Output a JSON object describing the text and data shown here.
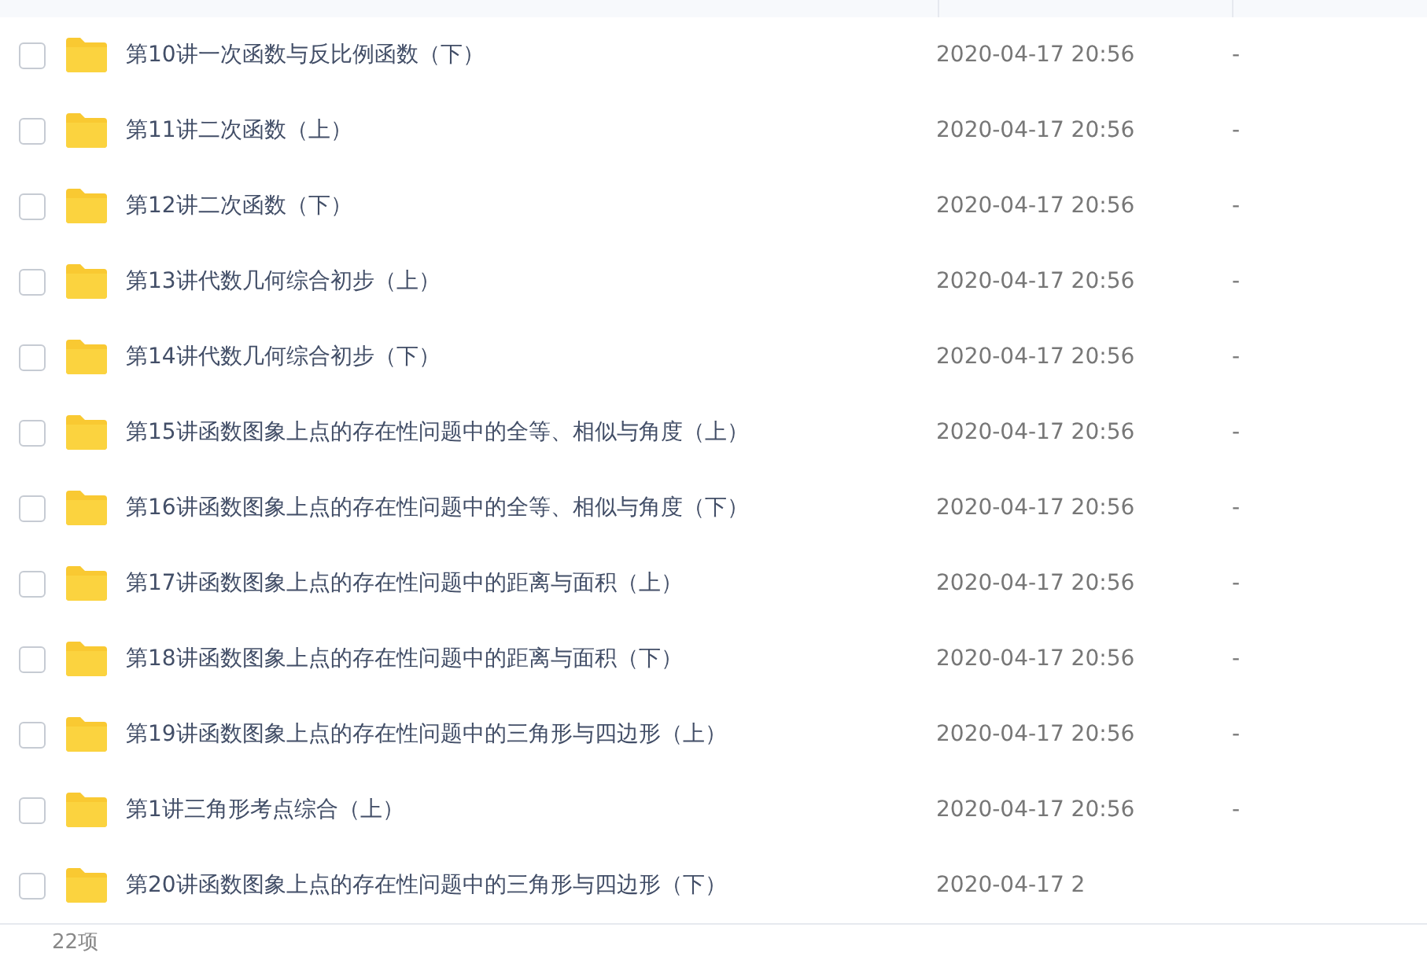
{
  "files": [
    {
      "name": "第10讲一次函数与反比例函数（下）",
      "modified": "2020-04-17 20:56",
      "size": "-",
      "checked": false
    },
    {
      "name": "第11讲二次函数（上）",
      "modified": "2020-04-17 20:56",
      "size": "-",
      "checked": false
    },
    {
      "name": "第12讲二次函数（下）",
      "modified": "2020-04-17 20:56",
      "size": "-",
      "checked": false
    },
    {
      "name": "第13讲代数几何综合初步（上）",
      "modified": "2020-04-17 20:56",
      "size": "-",
      "checked": false
    },
    {
      "name": "第14讲代数几何综合初步（下）",
      "modified": "2020-04-17 20:56",
      "size": "-",
      "checked": false
    },
    {
      "name": "第15讲函数图象上点的存在性问题中的全等、相似与角度（上）",
      "modified": "2020-04-17 20:56",
      "size": "-",
      "checked": false
    },
    {
      "name": "第16讲函数图象上点的存在性问题中的全等、相似与角度（下）",
      "modified": "2020-04-17 20:56",
      "size": "-",
      "checked": false
    },
    {
      "name": "第17讲函数图象上点的存在性问题中的距离与面积（上）",
      "modified": "2020-04-17 20:56",
      "size": "-",
      "checked": false
    },
    {
      "name": "第18讲函数图象上点的存在性问题中的距离与面积（下）",
      "modified": "2020-04-17 20:56",
      "size": "-",
      "checked": false
    },
    {
      "name": "第19讲函数图象上点的存在性问题中的三角形与四边形（上）",
      "modified": "2020-04-17 20:56",
      "size": "-",
      "checked": false
    },
    {
      "name": "第1讲三角形考点综合（上）",
      "modified": "2020-04-17 20:56",
      "size": "-",
      "checked": false
    },
    {
      "name": "第20讲函数图象上点的存在性问题中的三角形与四边形（下）",
      "modified": "2020-04-17 2",
      "checked": false
    }
  ],
  "status_bar": {
    "count": "22项"
  }
}
